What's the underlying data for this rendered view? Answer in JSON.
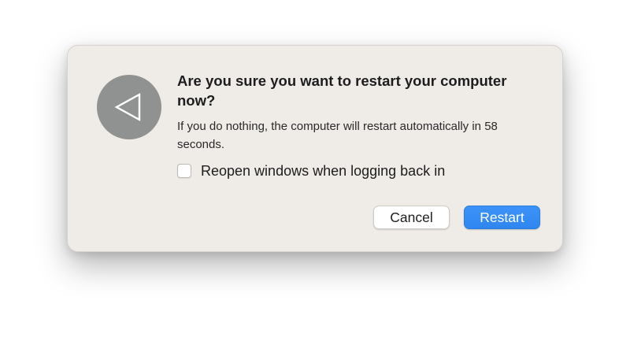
{
  "dialog": {
    "icon": "restart-triangle-icon",
    "title": "Are you sure you want to restart your computer now?",
    "message": "If you do nothing, the computer will restart automatically in 58 seconds.",
    "reopen_checkbox": {
      "label": "Reopen windows when logging back in",
      "checked": false
    },
    "buttons": {
      "cancel_label": "Cancel",
      "restart_label": "Restart"
    }
  },
  "colors": {
    "dialog_background": "#efebe7",
    "icon_background": "#8f9290",
    "primary_button": "#3a90f6"
  }
}
